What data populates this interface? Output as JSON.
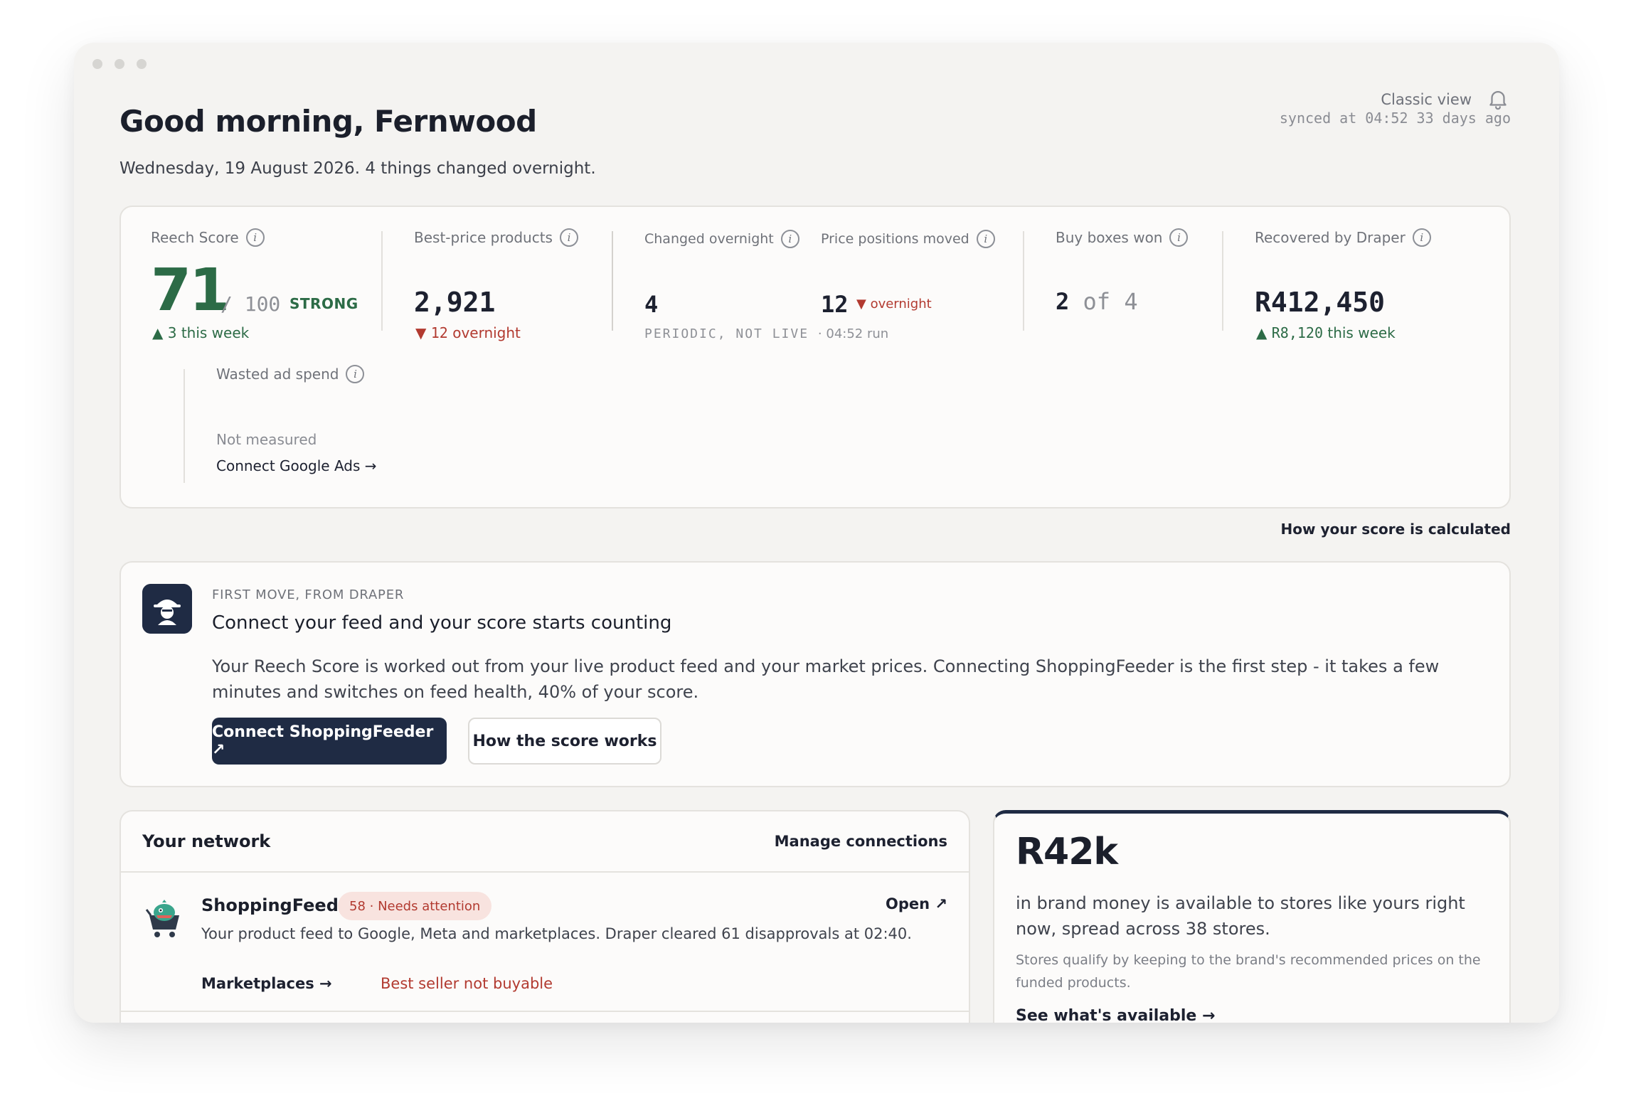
{
  "header": {
    "greeting": "Good morning, Fernwood",
    "subline": "Wednesday, 19 August 2026. 4 things changed overnight.",
    "classic_view": "Classic view",
    "synced": "synced at 04:52 33 days ago"
  },
  "metrics": {
    "reech_score": {
      "label": "Reech Score",
      "value": "71",
      "denominator": "/ 100",
      "status": "STRONG",
      "delta": "▲ 3 this week"
    },
    "best_price": {
      "label": "Best-price products",
      "value": "2,921",
      "delta_arrow": "▼",
      "delta_num": "12",
      "delta_text": "overnight"
    },
    "changed_overnight": {
      "label": "Changed overnight",
      "value": "4",
      "note": "PERIODIC, NOT LIVE",
      "note_run": "· 04:52 run"
    },
    "price_positions": {
      "label": "Price positions moved",
      "value": "12",
      "delta": "▼ overnight"
    },
    "buy_boxes": {
      "label": "Buy boxes won",
      "value": "2",
      "of": "of 4"
    },
    "recovered": {
      "label": "Recovered by Draper",
      "value": "R412,450",
      "delta_arrow": "▲",
      "delta_num": "R8,120",
      "delta_text": "this week"
    },
    "wasted_ad": {
      "label": "Wasted ad spend",
      "status": "Not measured",
      "link": "Connect Google Ads →"
    }
  },
  "how_calculated": "How your score is calculated",
  "first_move": {
    "kicker": "FIRST MOVE, FROM DRAPER",
    "title": "Connect your feed and your score starts counting",
    "body": "Your Reech Score is worked out from your live product feed and your market prices. Connecting ShoppingFeeder is the first step - it takes a few minutes and switches on feed health, 40% of your score.",
    "primary_button": "Connect ShoppingFeeder ↗",
    "secondary_button": "How the score works"
  },
  "network": {
    "title": "Your network",
    "manage": "Manage connections",
    "item": {
      "name": "ShoppingFeeder",
      "badge": "58 · Needs attention",
      "open": "Open ↗",
      "description": "Your product feed to Google, Meta and marketplaces. Draper cleared 61 disapprovals at 02:40.",
      "marketplaces": "Marketplaces →",
      "issue": "Best seller not buyable"
    }
  },
  "brand_money": {
    "amount": "R42k",
    "text": "in brand money is available to stores like yours right now, spread across 38 stores.",
    "small": "Stores qualify by keeping to the brand's recommended prices on the funded products.",
    "link": "See what's available →"
  },
  "colors": {
    "accent_navy": "#1f2b44",
    "positive_green": "#2c6b46",
    "negative_red": "#b23a30",
    "background": "#f4f3f1"
  },
  "icons": [
    "bell-icon",
    "info-icon",
    "draper-avatar-icon",
    "shoppingfeeder-logo-icon"
  ]
}
